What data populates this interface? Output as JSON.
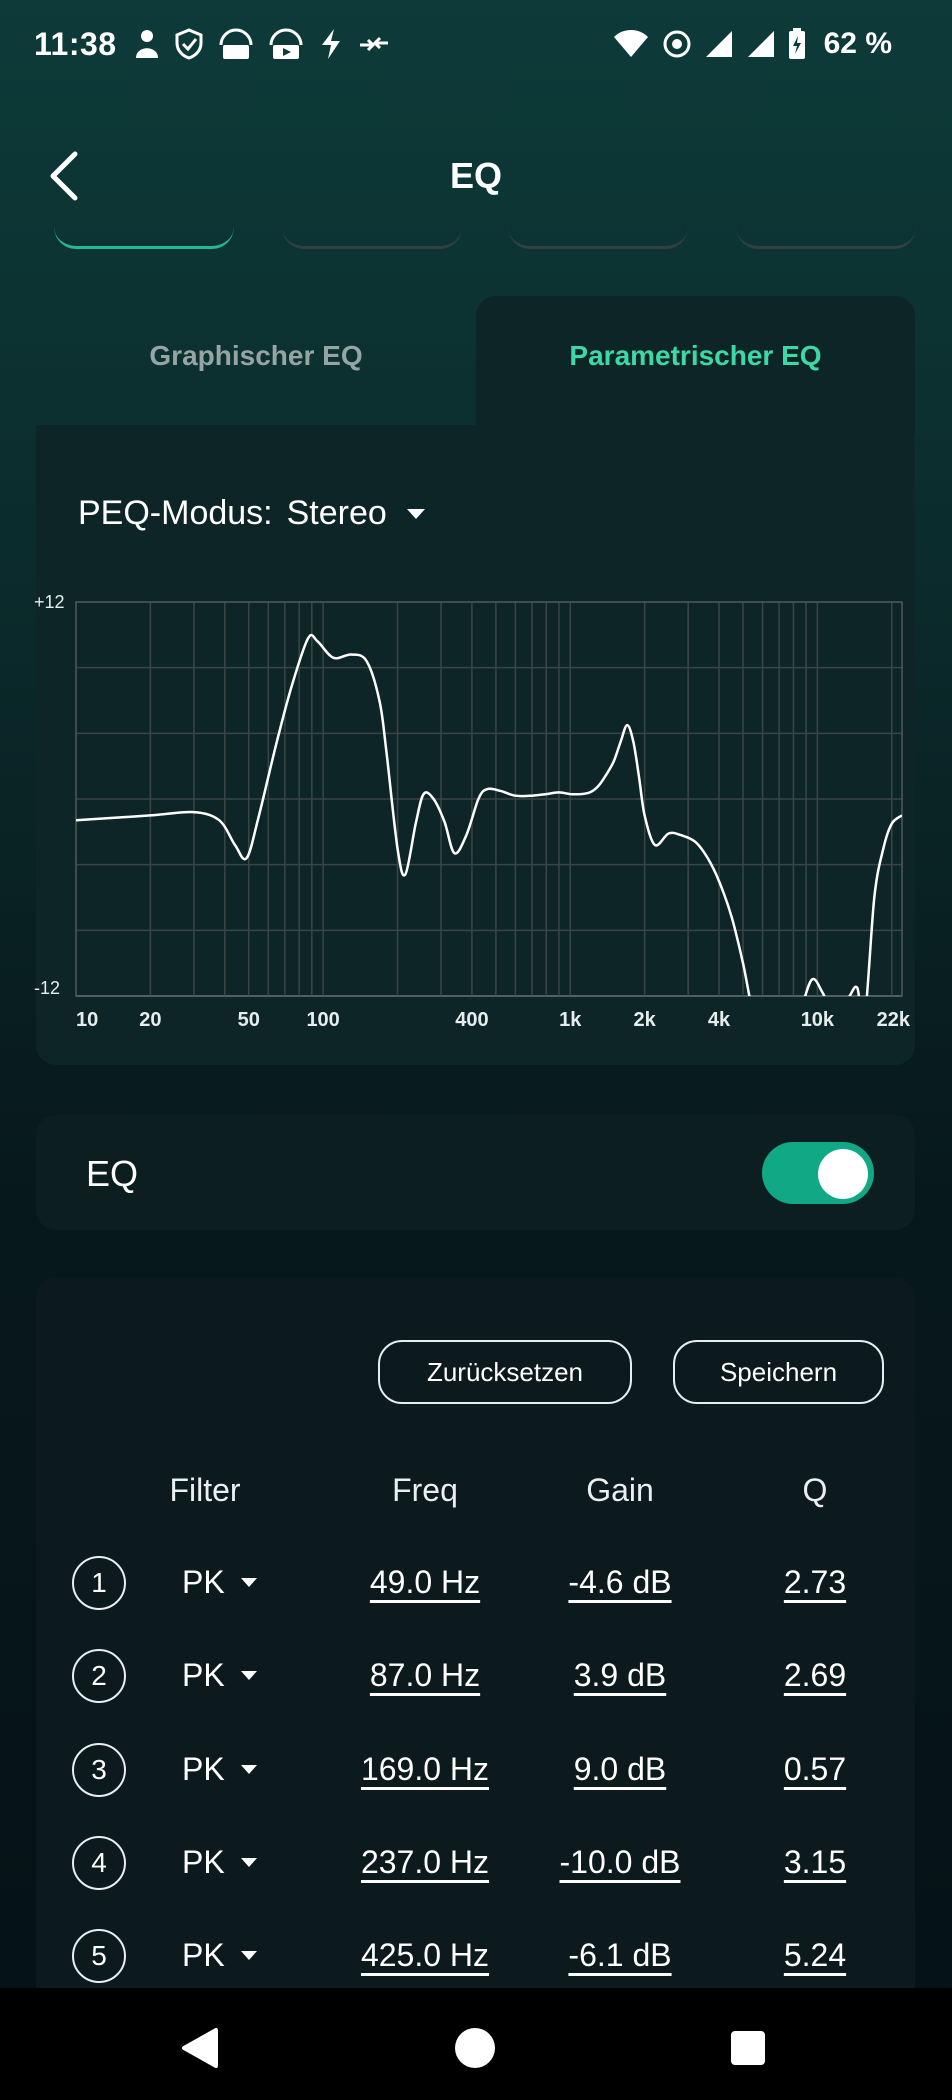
{
  "status_bar": {
    "time": "11:38",
    "battery": "62 %",
    "icons_left": [
      "person-icon",
      "shield-icon",
      "vpn-lock-icon",
      "vpn-lock-play-icon",
      "bolt-icon",
      "arrows-icon"
    ],
    "icons_right": [
      "wifi-icon",
      "hotspot-icon",
      "signal-icon",
      "signal-icon",
      "battery-icon"
    ]
  },
  "header": {
    "title": "EQ"
  },
  "tabs": [
    {
      "label": "Graphischer EQ",
      "active": false
    },
    {
      "label": "Parametrischer EQ",
      "active": true
    }
  ],
  "peq_mode": {
    "label": "PEQ-Modus:",
    "value": "Stereo"
  },
  "chart_data": {
    "type": "line",
    "x_scale": "log",
    "xlim": [
      10,
      22000
    ],
    "ylim": [
      -12,
      12
    ],
    "y_ticks": [
      "+12",
      "-12"
    ],
    "x_tick_labels": [
      "10",
      "20",
      "50",
      "100",
      "400",
      "1k",
      "2k",
      "4k",
      "10k",
      "22k"
    ],
    "x_tick_values": [
      10,
      20,
      50,
      100,
      400,
      1000,
      2000,
      4000,
      10000,
      22000
    ],
    "grid": true,
    "series": [
      {
        "x": [
          10,
          20,
          30,
          38,
          44,
          49,
          55,
          65,
          75,
          87,
          95,
          110,
          130,
          150,
          169,
          180,
          200,
          215,
          237,
          255,
          280,
          310,
          340,
          380,
          425,
          460,
          520,
          600,
          700,
          800,
          900,
          1000,
          1100,
          1200,
          1300,
          1400,
          1500,
          1600,
          1700,
          1800,
          1900,
          2000,
          2200,
          2500,
          2800,
          3200,
          3600,
          4000,
          4500,
          5000,
          5600,
          6500,
          7500,
          8500,
          9500,
          10500,
          11500,
          12500,
          13500,
          14500,
          15500,
          17000,
          18500,
          20000,
          22000
        ],
        "y": [
          -1.3,
          -1.0,
          -0.8,
          -1.3,
          -2.8,
          -3.6,
          -1.0,
          3.5,
          7.0,
          9.8,
          9.6,
          8.6,
          8.8,
          8.4,
          6.0,
          3.0,
          -3.0,
          -4.6,
          -1.5,
          0.3,
          0.0,
          -1.4,
          -3.3,
          -2.2,
          0.0,
          0.6,
          0.5,
          0.2,
          0.2,
          0.3,
          0.4,
          0.3,
          0.3,
          0.4,
          0.8,
          1.5,
          2.3,
          3.5,
          4.5,
          3.5,
          1.3,
          -1.0,
          -2.8,
          -2.1,
          -2.2,
          -2.6,
          -3.6,
          -5.0,
          -7.2,
          -10.0,
          -13.5,
          -15.0,
          -15.0,
          -13.0,
          -11.0,
          -11.8,
          -13.0,
          -12.8,
          -12.0,
          -11.5,
          -13.5,
          -6.0,
          -3.0,
          -1.5,
          -1.0
        ]
      }
    ]
  },
  "eq_toggle": {
    "label": "EQ",
    "enabled": true,
    "accent": "#11a886"
  },
  "filters": {
    "reset_label": "Zurücksetzen",
    "save_label": "Speichern",
    "columns": [
      "Filter",
      "Freq",
      "Gain",
      "Q"
    ],
    "rows": [
      {
        "index": "1",
        "type": "PK",
        "freq": "49.0 Hz",
        "gain": "-4.6 dB",
        "q": "2.73"
      },
      {
        "index": "2",
        "type": "PK",
        "freq": "87.0 Hz",
        "gain": "3.9 dB",
        "q": "2.69"
      },
      {
        "index": "3",
        "type": "PK",
        "freq": "169.0 Hz",
        "gain": "9.0 dB",
        "q": "0.57"
      },
      {
        "index": "4",
        "type": "PK",
        "freq": "237.0 Hz",
        "gain": "-10.0 dB",
        "q": "3.15"
      },
      {
        "index": "5",
        "type": "PK",
        "freq": "425.0 Hz",
        "gain": "-6.1 dB",
        "q": "5.24"
      }
    ]
  },
  "colors": {
    "accent_green": "#3cd9a7",
    "toggle_green": "#11a886",
    "panel": "#0e2527"
  }
}
